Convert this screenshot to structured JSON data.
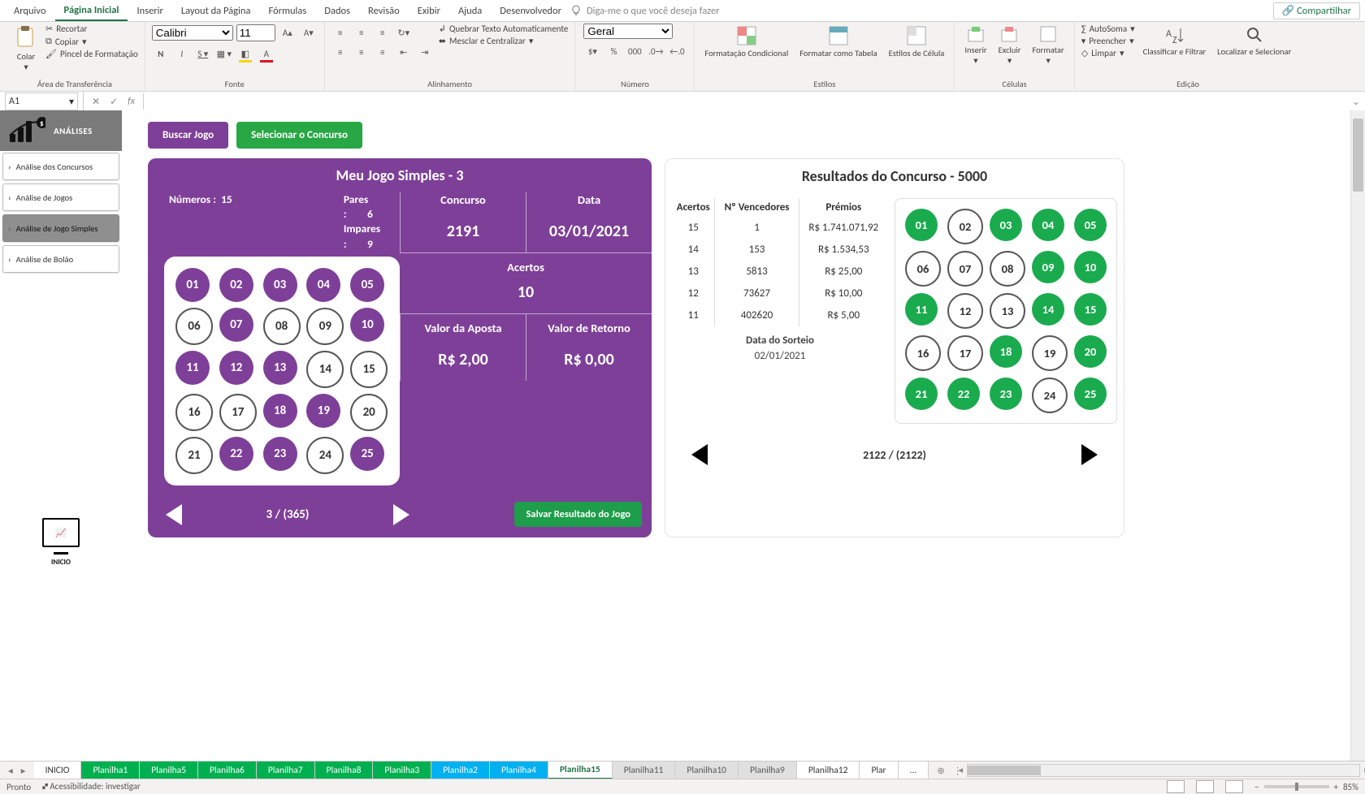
{
  "menu": {
    "file": "Arquivo",
    "home": "Página Inicial",
    "insert": "Inserir",
    "layout": "Layout da Página",
    "formulas": "Fórmulas",
    "data": "Dados",
    "review": "Revisão",
    "view": "Exibir",
    "help": "Ajuda",
    "dev": "Desenvolvedor",
    "tell": "Diga-me o que você deseja fazer",
    "share": "Compartilhar"
  },
  "ribbon": {
    "clipboard": {
      "paste": "Colar",
      "cut": "Recortar",
      "copy": "Copiar",
      "painter": "Pincel de Formatação",
      "label": "Área de Transferência"
    },
    "font": {
      "name": "Calibri",
      "size": "11",
      "label": "Fonte"
    },
    "align": {
      "wrap": "Quebrar Texto Automaticamente",
      "merge": "Mesclar e Centralizar",
      "label": "Alinhamento"
    },
    "number": {
      "format": "Geral",
      "label": "Número"
    },
    "styles": {
      "cf": "Formatação Condicional",
      "fat": "Formatar como Tabela",
      "cell": "Estilos de Célula",
      "label": "Estilos"
    },
    "cells": {
      "insert": "Inserir",
      "delete": "Excluir",
      "format": "Formatar",
      "label": "Células"
    },
    "editing": {
      "sum": "AutoSoma",
      "fill": "Preencher",
      "clear": "Limpar",
      "sort": "Classificar e Filtrar",
      "find": "Localizar e Selecionar",
      "label": "Edição"
    }
  },
  "namebox": "A1",
  "nav": {
    "title": "ANÁLISES",
    "items": [
      "Análise dos Concursos",
      "Análise de Jogos",
      "Análise de Jogo Simples",
      "Análise de Bolão"
    ],
    "inicio": "INICIO"
  },
  "buttons": {
    "buscar": "Buscar Jogo",
    "sel": "Selecionar o Concurso"
  },
  "left": {
    "title": "Meu Jogo Simples - 3",
    "numeros_l": "Números :",
    "numeros_v": "15",
    "pares_l": "Pares :",
    "pares_v": "6",
    "impares_l": "Impares :",
    "impares_v": "9",
    "balls_on": [
      1,
      2,
      3,
      4,
      5,
      7,
      10,
      11,
      12,
      13,
      18,
      19,
      22,
      23,
      25
    ],
    "concurso_l": "Concurso",
    "concurso_v": "2191",
    "data_l": "Data",
    "data_v": "03/01/2021",
    "acertos_l": "Acertos",
    "acertos_v": "10",
    "aposta_l": "Valor da Aposta",
    "aposta_v": "R$ 2,00",
    "retorno_l": "Valor de Retorno",
    "retorno_v": "R$ 0,00",
    "pager": "3 / (365)",
    "save": "Salvar Resultado do Jogo"
  },
  "right": {
    "title": "Resultados do Concurso - 5000",
    "h_acertos": "Acertos",
    "h_venc": "Nº Vencedores",
    "h_prem": "Prémios",
    "rows": [
      {
        "a": "15",
        "v": "1",
        "p": "R$ 1.741.071,92"
      },
      {
        "a": "14",
        "v": "153",
        "p": "R$ 1.534,53"
      },
      {
        "a": "13",
        "v": "5813",
        "p": "R$ 25,00"
      },
      {
        "a": "12",
        "v": "73627",
        "p": "R$ 10,00"
      },
      {
        "a": "11",
        "v": "402620",
        "p": "R$ 5,00"
      }
    ],
    "data_l": "Data do Sorteio",
    "data_v": "02/01/2021",
    "balls_on": [
      1,
      3,
      4,
      5,
      9,
      10,
      11,
      14,
      15,
      18,
      20,
      21,
      22,
      23,
      25
    ],
    "pager": "2122 / (2122)"
  },
  "sheets": {
    "inicio": "INICIO",
    "tabs": [
      "Planilha1",
      "Planilha5",
      "Planilha6",
      "Planilha7",
      "Planilha8",
      "Planilha3",
      "Planilha2",
      "Planilha4",
      "Planilha15",
      "Planilha11",
      "Planilha10",
      "Planilha9",
      "Planilha12",
      "Plar"
    ],
    "ellipsis": "..."
  },
  "status": {
    "ready": "Pronto",
    "acc": "Acessibilidade: investigar",
    "zoom": "85%"
  }
}
